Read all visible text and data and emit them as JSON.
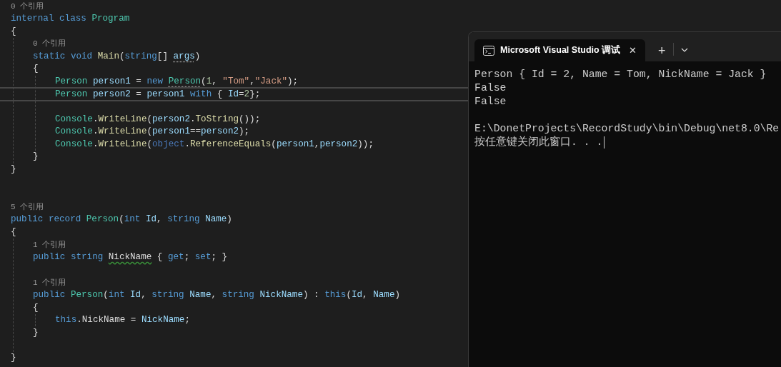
{
  "editor": {
    "lines": [
      {
        "kind": "lens",
        "text": "0 个引用"
      },
      {
        "kind": "code",
        "tokens": [
          {
            "text": "internal ",
            "kind": "kw"
          },
          {
            "text": "class ",
            "kind": "kw"
          },
          {
            "text": "Program",
            "kind": "type"
          }
        ]
      },
      {
        "kind": "code",
        "tokens": [
          {
            "text": "{",
            "kind": "plain"
          }
        ],
        "children": [
          {
            "kind": "lens",
            "text": "0 个引用"
          },
          {
            "kind": "code",
            "tokens": [
              {
                "text": "static ",
                "kind": "kw"
              },
              {
                "text": "void ",
                "kind": "kw"
              },
              {
                "text": "Main",
                "kind": "method"
              },
              {
                "text": "(",
                "kind": "plain"
              },
              {
                "text": "string",
                "kind": "kw"
              },
              {
                "text": "[] ",
                "kind": "plain"
              },
              {
                "text": "args",
                "kind": "var",
                "hint": true
              },
              {
                "text": ")",
                "kind": "plain"
              }
            ]
          },
          {
            "kind": "code",
            "tokens": [
              {
                "text": "{",
                "kind": "plain"
              }
            ],
            "children": [
              {
                "kind": "code",
                "tokens": [
                  {
                    "text": "Person ",
                    "kind": "type"
                  },
                  {
                    "text": "person1",
                    "kind": "var"
                  },
                  {
                    "text": " = ",
                    "kind": "plain"
                  },
                  {
                    "text": "new ",
                    "kind": "kw"
                  },
                  {
                    "text": "Person",
                    "kind": "type",
                    "hint": true
                  },
                  {
                    "text": "(",
                    "kind": "plain"
                  },
                  {
                    "text": "1",
                    "kind": "num"
                  },
                  {
                    "text": ", ",
                    "kind": "plain"
                  },
                  {
                    "text": "\"Tom\"",
                    "kind": "str"
                  },
                  {
                    "text": ",",
                    "kind": "plain"
                  },
                  {
                    "text": "\"Jack\"",
                    "kind": "str"
                  },
                  {
                    "text": ");",
                    "kind": "plain"
                  }
                ]
              },
              {
                "kind": "code",
                "current": true,
                "tokens": [
                  {
                    "text": "Person ",
                    "kind": "type"
                  },
                  {
                    "text": "person2",
                    "kind": "var"
                  },
                  {
                    "text": " = ",
                    "kind": "plain"
                  },
                  {
                    "text": "person1 ",
                    "kind": "var"
                  },
                  {
                    "text": "with",
                    "kind": "kw"
                  },
                  {
                    "text": " { ",
                    "kind": "plain"
                  },
                  {
                    "text": "Id",
                    "kind": "var"
                  },
                  {
                    "text": "=",
                    "kind": "plain"
                  },
                  {
                    "text": "2",
                    "kind": "num"
                  },
                  {
                    "text": "};",
                    "kind": "plain"
                  }
                ]
              },
              {
                "kind": "blank"
              },
              {
                "kind": "code",
                "tokens": [
                  {
                    "text": "Console",
                    "kind": "type"
                  },
                  {
                    "text": ".",
                    "kind": "plain"
                  },
                  {
                    "text": "WriteLine",
                    "kind": "method"
                  },
                  {
                    "text": "(",
                    "kind": "plain"
                  },
                  {
                    "text": "person2",
                    "kind": "var"
                  },
                  {
                    "text": ".",
                    "kind": "plain"
                  },
                  {
                    "text": "ToString",
                    "kind": "method"
                  },
                  {
                    "text": "());",
                    "kind": "plain"
                  }
                ]
              },
              {
                "kind": "code",
                "tokens": [
                  {
                    "text": "Console",
                    "kind": "type"
                  },
                  {
                    "text": ".",
                    "kind": "plain"
                  },
                  {
                    "text": "WriteLine",
                    "kind": "method"
                  },
                  {
                    "text": "(",
                    "kind": "plain"
                  },
                  {
                    "text": "person1",
                    "kind": "var"
                  },
                  {
                    "text": "==",
                    "kind": "plain"
                  },
                  {
                    "text": "person2",
                    "kind": "var"
                  },
                  {
                    "text": ");",
                    "kind": "plain"
                  }
                ]
              },
              {
                "kind": "code",
                "tokens": [
                  {
                    "text": "Console",
                    "kind": "type"
                  },
                  {
                    "text": ".",
                    "kind": "plain"
                  },
                  {
                    "text": "WriteLine",
                    "kind": "method"
                  },
                  {
                    "text": "(",
                    "kind": "plain"
                  },
                  {
                    "text": "object",
                    "kind": "kw2"
                  },
                  {
                    "text": ".",
                    "kind": "plain"
                  },
                  {
                    "text": "ReferenceEquals",
                    "kind": "method"
                  },
                  {
                    "text": "(",
                    "kind": "plain"
                  },
                  {
                    "text": "person1",
                    "kind": "var"
                  },
                  {
                    "text": ",",
                    "kind": "plain"
                  },
                  {
                    "text": "person2",
                    "kind": "var"
                  },
                  {
                    "text": "));",
                    "kind": "plain"
                  }
                ]
              }
            ]
          },
          {
            "kind": "code",
            "tokens": [
              {
                "text": "}",
                "kind": "plain"
              }
            ]
          }
        ]
      },
      {
        "kind": "code",
        "tokens": [
          {
            "text": "}",
            "kind": "plain"
          }
        ]
      },
      {
        "kind": "blank"
      },
      {
        "kind": "blank"
      },
      {
        "kind": "lens",
        "text": "5 个引用"
      },
      {
        "kind": "code",
        "tokens": [
          {
            "text": "public ",
            "kind": "kw"
          },
          {
            "text": "record ",
            "kind": "kw"
          },
          {
            "text": "Person",
            "kind": "type"
          },
          {
            "text": "(",
            "kind": "plain"
          },
          {
            "text": "int ",
            "kind": "kw"
          },
          {
            "text": "Id",
            "kind": "var"
          },
          {
            "text": ", ",
            "kind": "plain"
          },
          {
            "text": "string ",
            "kind": "kw"
          },
          {
            "text": "Name",
            "kind": "var"
          },
          {
            "text": ")",
            "kind": "plain"
          }
        ]
      },
      {
        "kind": "code",
        "tokens": [
          {
            "text": "{",
            "kind": "plain"
          }
        ],
        "children": [
          {
            "kind": "lens",
            "text": "1 个引用"
          },
          {
            "kind": "code",
            "tokens": [
              {
                "text": "public ",
                "kind": "kw"
              },
              {
                "text": "string ",
                "kind": "kw"
              },
              {
                "text": "NickName",
                "kind": "plain",
                "warning": true
              },
              {
                "text": " { ",
                "kind": "plain"
              },
              {
                "text": "get",
                "kind": "kw"
              },
              {
                "text": "; ",
                "kind": "plain"
              },
              {
                "text": "set",
                "kind": "kw"
              },
              {
                "text": "; }",
                "kind": "plain"
              }
            ]
          },
          {
            "kind": "blank"
          },
          {
            "kind": "lens",
            "text": "1 个引用"
          },
          {
            "kind": "code",
            "tokens": [
              {
                "text": "public ",
                "kind": "kw"
              },
              {
                "text": "Person",
                "kind": "type"
              },
              {
                "text": "(",
                "kind": "plain"
              },
              {
                "text": "int ",
                "kind": "kw"
              },
              {
                "text": "Id",
                "kind": "var"
              },
              {
                "text": ", ",
                "kind": "plain"
              },
              {
                "text": "string ",
                "kind": "kw"
              },
              {
                "text": "Name",
                "kind": "var"
              },
              {
                "text": ", ",
                "kind": "plain"
              },
              {
                "text": "string ",
                "kind": "kw"
              },
              {
                "text": "NickName",
                "kind": "var"
              },
              {
                "text": ") : ",
                "kind": "plain"
              },
              {
                "text": "this",
                "kind": "kw"
              },
              {
                "text": "(",
                "kind": "plain"
              },
              {
                "text": "Id",
                "kind": "var"
              },
              {
                "text": ", ",
                "kind": "plain"
              },
              {
                "text": "Name",
                "kind": "var"
              },
              {
                "text": ")",
                "kind": "plain"
              }
            ]
          },
          {
            "kind": "code",
            "tokens": [
              {
                "text": "{",
                "kind": "plain"
              }
            ],
            "children": [
              {
                "kind": "code",
                "tokens": [
                  {
                    "text": "this",
                    "kind": "kw"
                  },
                  {
                    "text": ".NickName = ",
                    "kind": "plain"
                  },
                  {
                    "text": "NickName",
                    "kind": "var"
                  },
                  {
                    "text": ";",
                    "kind": "plain"
                  }
                ]
              }
            ]
          },
          {
            "kind": "code",
            "tokens": [
              {
                "text": "}",
                "kind": "plain"
              }
            ]
          },
          {
            "kind": "blank"
          }
        ]
      },
      {
        "kind": "code",
        "tokens": [
          {
            "text": "}",
            "kind": "plain"
          }
        ]
      }
    ]
  },
  "terminal": {
    "tab": {
      "title": "Microsoft Visual Studio 调试",
      "close": "✕",
      "selected": true
    },
    "new_tab": "+",
    "output": [
      {
        "kind": "text",
        "text": "Person { Id = 2, Name = Tom, NickName = Jack }"
      },
      {
        "kind": "text",
        "text": "False"
      },
      {
        "kind": "text",
        "text": "False"
      },
      {
        "kind": "blank"
      },
      {
        "kind": "text",
        "text": "E:\\DonetProjects\\RecordStudy\\bin\\Debug\\net8.0\\Re"
      },
      {
        "kind": "text",
        "text": "按任意键关闭此窗口. . ."
      }
    ]
  }
}
